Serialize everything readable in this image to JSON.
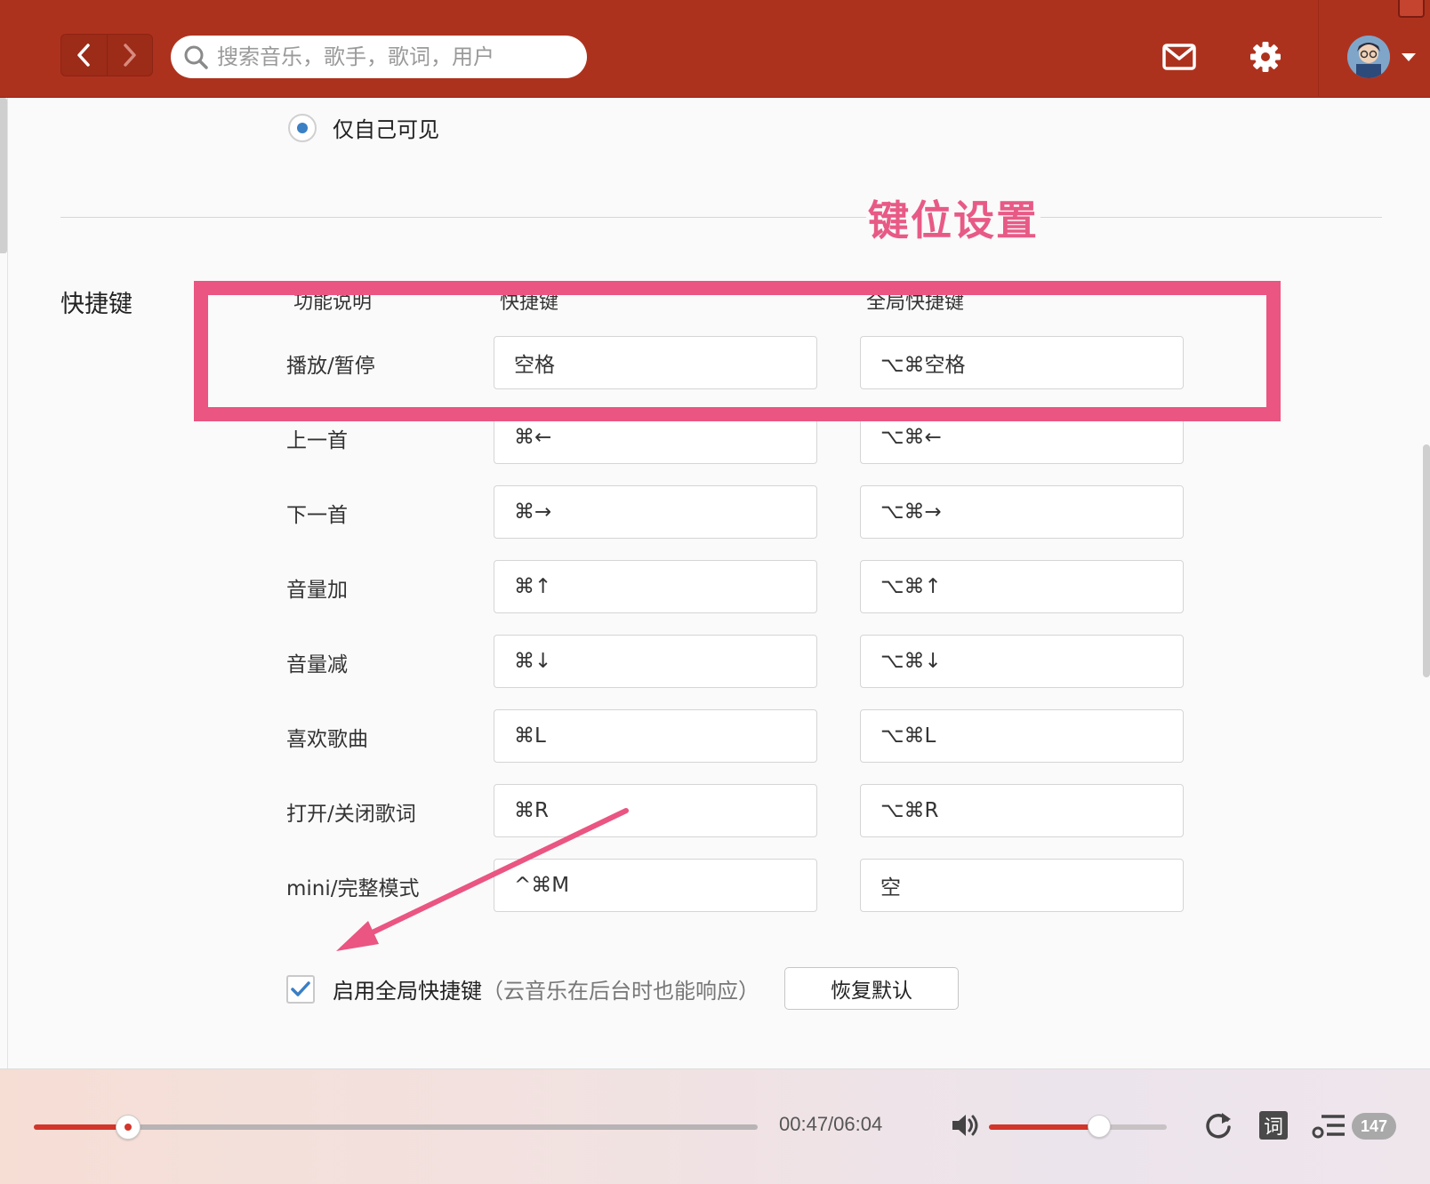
{
  "topbar": {
    "search_placeholder": "搜索音乐，歌手，歌词，用户",
    "icons": [
      "chevron-left-icon",
      "chevron-right-icon",
      "search-icon",
      "mail-icon",
      "gear-icon",
      "avatar",
      "caret-down-icon"
    ]
  },
  "privacy": {
    "option_label": "仅自己可见",
    "selected": true
  },
  "annotation": {
    "title": "键位设置"
  },
  "shortcuts": {
    "section_label": "快捷键",
    "headers": {
      "function": "功能说明",
      "shortcut": "快捷键",
      "global": "全局快捷键"
    },
    "rows": [
      {
        "label": "播放/暂停",
        "shortcut": "空格",
        "global": "⌥⌘空格"
      },
      {
        "label": "上一首",
        "shortcut": "⌘←",
        "global": "⌥⌘←"
      },
      {
        "label": "下一首",
        "shortcut": "⌘→",
        "global": "⌥⌘→"
      },
      {
        "label": "音量加",
        "shortcut": "⌘↑",
        "global": "⌥⌘↑"
      },
      {
        "label": "音量减",
        "shortcut": "⌘↓",
        "global": "⌥⌘↓"
      },
      {
        "label": "喜欢歌曲",
        "shortcut": "⌘L",
        "global": "⌥⌘L"
      },
      {
        "label": "打开/关闭歌词",
        "shortcut": "⌘R",
        "global": "⌥⌘R"
      },
      {
        "label": "mini/完整模式",
        "shortcut": "^⌘M",
        "global": "空"
      }
    ],
    "enable_global_label": "启用全局快捷键",
    "enable_global_hint": "（云音乐在后台时也能响应）",
    "enable_global_checked": true,
    "restore_label": "恢复默认"
  },
  "player": {
    "time": "00:47/06:04",
    "progress": 0.13,
    "volume": 0.62,
    "lyric_label": "词",
    "playlist_count": "147"
  },
  "colors": {
    "topbar": "#ad321e",
    "accent": "#d2352a",
    "annotation": "#ea5582",
    "radio": "#3b7fc4"
  }
}
